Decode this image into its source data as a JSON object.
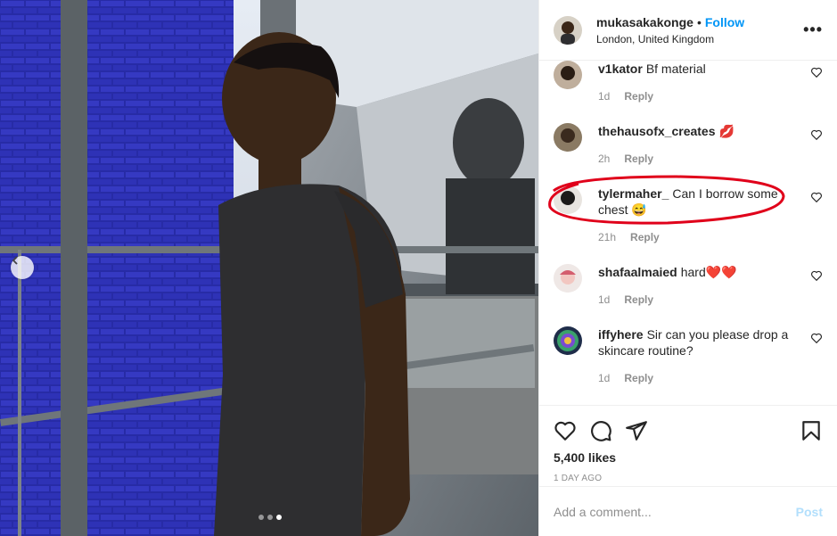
{
  "post": {
    "username": "mukasakakonge",
    "separator": "•",
    "follow_label": "Follow",
    "location": "London, United Kingdom",
    "more_label": "•••"
  },
  "comments": [
    {
      "user": "v1kator",
      "text": "Bf material",
      "emoji": "",
      "time": "1d",
      "reply": "Reply"
    },
    {
      "user": "thehausofx_creates",
      "text": "",
      "emoji": "💋",
      "time": "2h",
      "reply": "Reply"
    },
    {
      "user": "tylermaher_",
      "text": "Can I borrow some chest",
      "emoji": "😅",
      "time": "21h",
      "reply": "Reply",
      "highlighted": true
    },
    {
      "user": "shafaalmaied",
      "text": "hard",
      "emoji": "❤️❤️",
      "time": "1d",
      "reply": "Reply"
    },
    {
      "user": "iffyhere",
      "text": "Sir can you please drop a skincare routine?",
      "emoji": "",
      "time": "1d",
      "reply": "Reply"
    }
  ],
  "stats": {
    "likes": "5,400 likes",
    "posted_ago": "1 DAY AGO"
  },
  "composer": {
    "placeholder": "Add a comment...",
    "post_label": "Post"
  },
  "carousel": {
    "prev_icon": "chevron-left-icon",
    "slide_count": 3,
    "active_slide": 3
  },
  "colors": {
    "follow": "#0095f6",
    "muted": "#8e8e8e",
    "post_disabled": "#b2dffc",
    "highlight_circle": "#e0001a"
  }
}
